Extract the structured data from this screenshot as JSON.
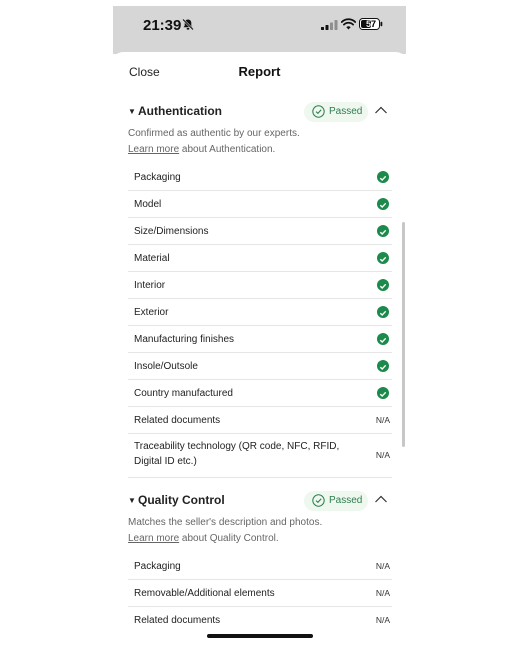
{
  "status_bar": {
    "time": "21:39",
    "battery": "57"
  },
  "nav": {
    "close_label": "Close",
    "title": "Report"
  },
  "authentication": {
    "title": "Authentication",
    "badge": "Passed",
    "description": "Confirmed as authentic by our experts.",
    "link_text": "Learn more",
    "link_suffix": " about Authentication.",
    "rows": [
      {
        "label": "Packaging",
        "status": "check"
      },
      {
        "label": "Model",
        "status": "check"
      },
      {
        "label": "Size/Dimensions",
        "status": "check"
      },
      {
        "label": "Material",
        "status": "check"
      },
      {
        "label": "Interior",
        "status": "check"
      },
      {
        "label": "Exterior",
        "status": "check"
      },
      {
        "label": "Manufacturing finishes",
        "status": "check"
      },
      {
        "label": "Insole/Outsole",
        "status": "check"
      },
      {
        "label": "Country manufactured",
        "status": "check"
      },
      {
        "label": "Related documents",
        "status": "N/A"
      },
      {
        "label_line1": "Traceability technology (QR code, NFC, RFID,",
        "label_line2": "Digital ID etc.)",
        "status": "N/A"
      }
    ]
  },
  "quality_control": {
    "title": "Quality Control",
    "badge": "Passed",
    "description": "Matches the seller's description and photos.",
    "link_text": "Learn more",
    "link_suffix": " about Quality Control.",
    "rows": [
      {
        "label": "Packaging",
        "status": "N/A"
      },
      {
        "label": "Removable/Additional elements",
        "status": "N/A"
      },
      {
        "label": "Related documents",
        "status": "N/A"
      }
    ]
  },
  "colors": {
    "accent_green": "#1b8a4a",
    "badge_bg": "#eef8ef"
  }
}
